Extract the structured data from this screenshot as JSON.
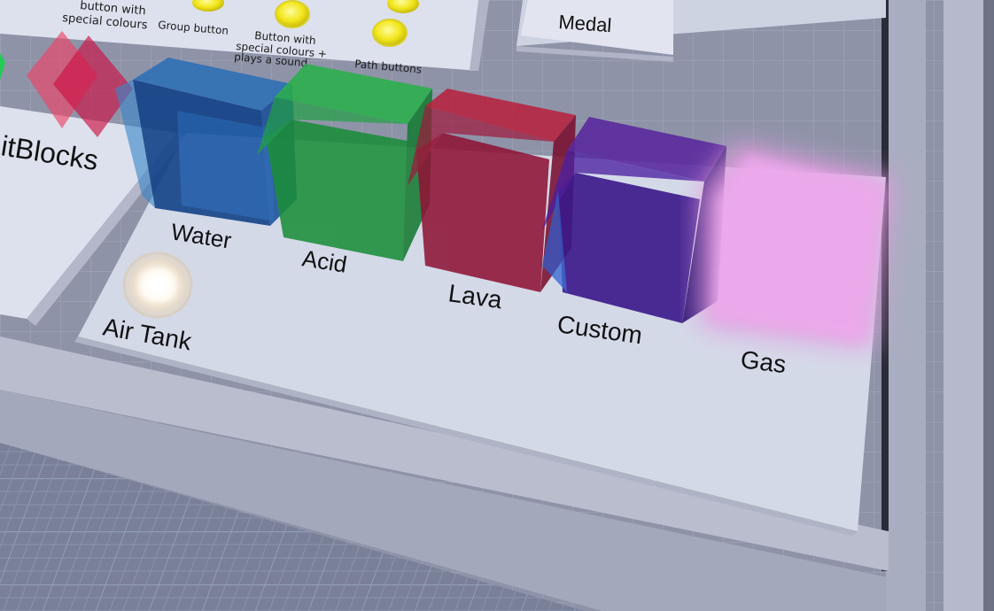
{
  "signs": {
    "top_left_line1": "button with",
    "top_left_line2": "special colours",
    "group_button": "Group button",
    "button_sound_line1": "Button with",
    "button_sound_line2": "special colours +",
    "button_sound_line3": "plays a sound",
    "path_buttons": "Path buttons",
    "medal": "Medal",
    "hitblocks": "itBlocks"
  },
  "liquids": [
    {
      "label": "Water",
      "color": "#1d5aa8"
    },
    {
      "label": "Acid",
      "color": "#1f9a3a"
    },
    {
      "label": "Lava",
      "color": "#a8143c"
    },
    {
      "label": "Custom",
      "color": "#4a1fa0"
    },
    {
      "label": "Gas",
      "color": "#e08fe0"
    }
  ],
  "air_tank": {
    "label": "Air Tank"
  },
  "colors": {
    "platform": "#d4d9e8",
    "floor": "#8d92a6",
    "button_yellow": "#f2e61a"
  }
}
